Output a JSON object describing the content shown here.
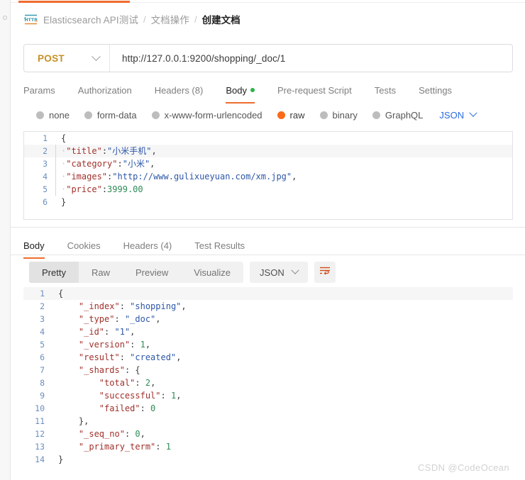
{
  "window": {
    "watermark": "CSDN @CodeOcean",
    "accent_orange": "#ef6c2e",
    "method_color": "#c79024",
    "link_blue": "#2b6ddf"
  },
  "breadcrumb": {
    "icon": "http-protocol-icon",
    "items": [
      "Elasticsearch API测试",
      "文档操作"
    ],
    "separator": "/",
    "current": "创建文档"
  },
  "request": {
    "method": "POST",
    "url": "http://127.0.0.1:9200/shopping/_doc/1",
    "tabs": [
      {
        "label": "Params",
        "active": false,
        "dot": false
      },
      {
        "label": "Authorization",
        "active": false,
        "dot": false
      },
      {
        "label": "Headers (8)",
        "active": false,
        "dot": false
      },
      {
        "label": "Body",
        "active": true,
        "dot": true
      },
      {
        "label": "Pre-request Script",
        "active": false,
        "dot": false
      },
      {
        "label": "Tests",
        "active": false,
        "dot": false
      },
      {
        "label": "Settings",
        "active": false,
        "dot": false
      }
    ],
    "body_types": [
      {
        "label": "none",
        "selected": false
      },
      {
        "label": "form-data",
        "selected": false
      },
      {
        "label": "x-www-form-urlencoded",
        "selected": false
      },
      {
        "label": "raw",
        "selected": true
      },
      {
        "label": "binary",
        "selected": false
      },
      {
        "label": "GraphQL",
        "selected": false
      }
    ],
    "format": "JSON",
    "body_lines": [
      {
        "num": "1",
        "guide": false,
        "highlight": false,
        "tokens": [
          {
            "t": "p",
            "v": "{"
          }
        ]
      },
      {
        "num": "2",
        "guide": true,
        "highlight": true,
        "tokens": [
          {
            "t": "dot",
            "v": "·"
          },
          {
            "t": "k",
            "v": "\"title\""
          },
          {
            "t": "p",
            "v": ":"
          },
          {
            "t": "s",
            "v": "\"小米手机\""
          },
          {
            "t": "p",
            "v": ","
          }
        ]
      },
      {
        "num": "3",
        "guide": true,
        "highlight": false,
        "tokens": [
          {
            "t": "dot",
            "v": "·"
          },
          {
            "t": "k",
            "v": "\"category\""
          },
          {
            "t": "p",
            "v": ":"
          },
          {
            "t": "s",
            "v": "\"小米\""
          },
          {
            "t": "p",
            "v": ","
          }
        ]
      },
      {
        "num": "4",
        "guide": true,
        "highlight": false,
        "tokens": [
          {
            "t": "dot",
            "v": "·"
          },
          {
            "t": "k",
            "v": "\"images\""
          },
          {
            "t": "p",
            "v": ":"
          },
          {
            "t": "s",
            "v": "\"http://www.gulixueyuan.com/xm.jpg\""
          },
          {
            "t": "p",
            "v": ","
          }
        ]
      },
      {
        "num": "5",
        "guide": true,
        "highlight": false,
        "tokens": [
          {
            "t": "dot",
            "v": "·"
          },
          {
            "t": "k",
            "v": "\"price\""
          },
          {
            "t": "p",
            "v": ":"
          },
          {
            "t": "n",
            "v": "3999.00"
          }
        ]
      },
      {
        "num": "6",
        "guide": false,
        "highlight": false,
        "tokens": [
          {
            "t": "p",
            "v": "}"
          }
        ]
      }
    ]
  },
  "response": {
    "tabs": [
      {
        "label": "Body",
        "active": true
      },
      {
        "label": "Cookies",
        "active": false
      },
      {
        "label": "Headers (4)",
        "active": false
      },
      {
        "label": "Test Results",
        "active": false
      }
    ],
    "view_modes": [
      {
        "label": "Pretty",
        "active": true
      },
      {
        "label": "Raw",
        "active": false
      },
      {
        "label": "Preview",
        "active": false
      },
      {
        "label": "Visualize",
        "active": false
      }
    ],
    "format": "JSON",
    "wrap_icon": "wrap-lines-icon",
    "body_lines": [
      {
        "num": "1",
        "highlight": true,
        "tokens": [
          {
            "t": "p",
            "v": "{"
          }
        ]
      },
      {
        "num": "2",
        "highlight": false,
        "tokens": [
          {
            "t": "p",
            "v": "    "
          },
          {
            "t": "k",
            "v": "\"_index\""
          },
          {
            "t": "p",
            "v": ": "
          },
          {
            "t": "s",
            "v": "\"shopping\""
          },
          {
            "t": "p",
            "v": ","
          }
        ]
      },
      {
        "num": "3",
        "highlight": false,
        "tokens": [
          {
            "t": "p",
            "v": "    "
          },
          {
            "t": "k",
            "v": "\"_type\""
          },
          {
            "t": "p",
            "v": ": "
          },
          {
            "t": "s",
            "v": "\"_doc\""
          },
          {
            "t": "p",
            "v": ","
          }
        ]
      },
      {
        "num": "4",
        "highlight": false,
        "tokens": [
          {
            "t": "p",
            "v": "    "
          },
          {
            "t": "k",
            "v": "\"_id\""
          },
          {
            "t": "p",
            "v": ": "
          },
          {
            "t": "s",
            "v": "\"1\""
          },
          {
            "t": "p",
            "v": ","
          }
        ]
      },
      {
        "num": "5",
        "highlight": false,
        "tokens": [
          {
            "t": "p",
            "v": "    "
          },
          {
            "t": "k",
            "v": "\"_version\""
          },
          {
            "t": "p",
            "v": ": "
          },
          {
            "t": "n",
            "v": "1"
          },
          {
            "t": "p",
            "v": ","
          }
        ]
      },
      {
        "num": "6",
        "highlight": false,
        "tokens": [
          {
            "t": "p",
            "v": "    "
          },
          {
            "t": "k",
            "v": "\"result\""
          },
          {
            "t": "p",
            "v": ": "
          },
          {
            "t": "s",
            "v": "\"created\""
          },
          {
            "t": "p",
            "v": ","
          }
        ]
      },
      {
        "num": "7",
        "highlight": false,
        "tokens": [
          {
            "t": "p",
            "v": "    "
          },
          {
            "t": "k",
            "v": "\"_shards\""
          },
          {
            "t": "p",
            "v": ": {"
          }
        ]
      },
      {
        "num": "8",
        "highlight": false,
        "tokens": [
          {
            "t": "p",
            "v": "        "
          },
          {
            "t": "k",
            "v": "\"total\""
          },
          {
            "t": "p",
            "v": ": "
          },
          {
            "t": "n",
            "v": "2"
          },
          {
            "t": "p",
            "v": ","
          }
        ]
      },
      {
        "num": "9",
        "highlight": false,
        "tokens": [
          {
            "t": "p",
            "v": "        "
          },
          {
            "t": "k",
            "v": "\"successful\""
          },
          {
            "t": "p",
            "v": ": "
          },
          {
            "t": "n",
            "v": "1"
          },
          {
            "t": "p",
            "v": ","
          }
        ]
      },
      {
        "num": "10",
        "highlight": false,
        "tokens": [
          {
            "t": "p",
            "v": "        "
          },
          {
            "t": "k",
            "v": "\"failed\""
          },
          {
            "t": "p",
            "v": ": "
          },
          {
            "t": "n",
            "v": "0"
          }
        ]
      },
      {
        "num": "11",
        "highlight": false,
        "tokens": [
          {
            "t": "p",
            "v": "    },"
          }
        ]
      },
      {
        "num": "12",
        "highlight": false,
        "tokens": [
          {
            "t": "p",
            "v": "    "
          },
          {
            "t": "k",
            "v": "\"_seq_no\""
          },
          {
            "t": "p",
            "v": ": "
          },
          {
            "t": "n",
            "v": "0"
          },
          {
            "t": "p",
            "v": ","
          }
        ]
      },
      {
        "num": "13",
        "highlight": false,
        "tokens": [
          {
            "t": "p",
            "v": "    "
          },
          {
            "t": "k",
            "v": "\"_primary_term\""
          },
          {
            "t": "p",
            "v": ": "
          },
          {
            "t": "n",
            "v": "1"
          }
        ]
      },
      {
        "num": "14",
        "highlight": false,
        "tokens": [
          {
            "t": "p",
            "v": "}"
          }
        ]
      }
    ]
  }
}
